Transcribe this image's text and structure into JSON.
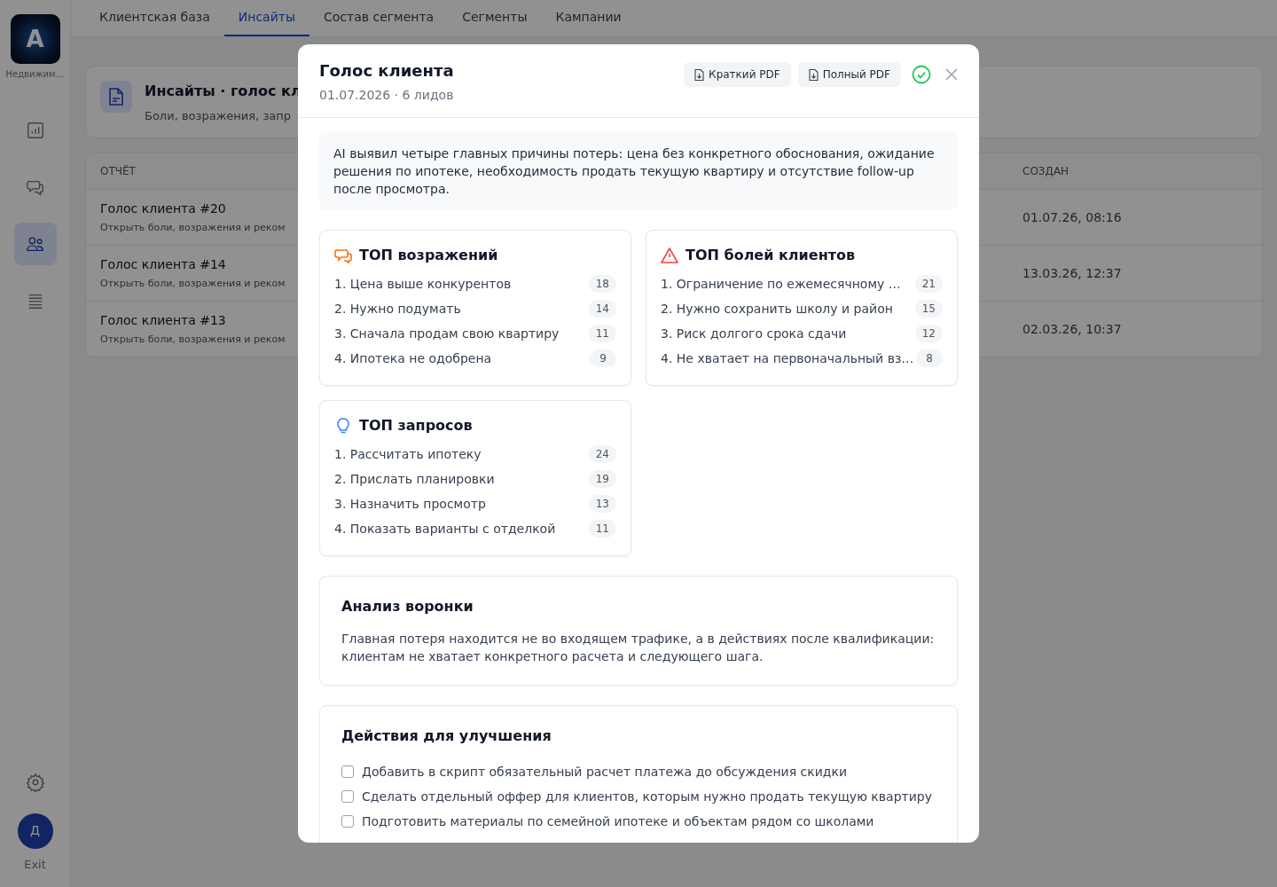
{
  "sidebar": {
    "logo_letter": "A",
    "workspace": "Недвижим…",
    "items": [
      {
        "kind": "chart",
        "selected": false
      },
      {
        "kind": "chat",
        "selected": false
      },
      {
        "kind": "users",
        "selected": true
      },
      {
        "kind": "list",
        "selected": false
      }
    ],
    "avatar": "Д",
    "exit": "Exit"
  },
  "tabs": [
    {
      "label": "Клиентская база",
      "selected": false
    },
    {
      "label": "Инсайты",
      "selected": true
    },
    {
      "label": "Состав сегмента",
      "selected": false
    },
    {
      "label": "Сегменты",
      "selected": false
    },
    {
      "label": "Кампании",
      "selected": false
    }
  ],
  "header": {
    "title": "Инсайты · голос кл",
    "subtitle": "Боли, возражения, запр"
  },
  "table": {
    "columns": [
      "ОТЧЁТ",
      "СОЗДАН"
    ],
    "rows": [
      {
        "title": "Голос клиента #20",
        "link": "Открыть боли, возражения и реком",
        "created": "01.07.26, 08:16"
      },
      {
        "title": "Голос клиента #14",
        "link": "Открыть боли, возражения и реком",
        "created": "13.03.26, 12:37"
      },
      {
        "title": "Голос клиента #13",
        "link": "Открыть боли, возражения и реком",
        "created": "02.03.26, 10:37"
      }
    ]
  },
  "modal": {
    "title": "Голос клиента",
    "subtitle": "01.07.2026 · 6 лидов",
    "buttons": [
      "Краткий PDF",
      "Полный PDF"
    ],
    "summary": "AI выявил четыре главных причины потерь: цена без конкретного обоснования, ожидание решения по ипотеке, необходимость продать текущую квартиру и отсутствие follow-up после просмотра.",
    "sections": [
      {
        "kind": "chat",
        "title": "ТОП возражений",
        "items": [
          {
            "text": "1. Цена выше конкурентов",
            "count": "18"
          },
          {
            "text": "2. Нужно подумать",
            "count": "14"
          },
          {
            "text": "3. Сначала продам свою квартиру",
            "count": "11"
          },
          {
            "text": "4. Ипотека не одобрена",
            "count": "9"
          }
        ]
      },
      {
        "kind": "alert",
        "title": "ТОП болей клиентов",
        "items": [
          {
            "text": "1. Ограничение по ежемесячному …",
            "count": "21"
          },
          {
            "text": "2. Нужно сохранить школу и район",
            "count": "15"
          },
          {
            "text": "3. Риск долгого срока сдачи",
            "count": "12"
          },
          {
            "text": "4. Не хватает на первоначальный вз…",
            "count": "8"
          }
        ]
      },
      {
        "kind": "idea",
        "title": "ТОП запросов",
        "items": [
          {
            "text": "1. Рассчитать ипотеку",
            "count": "24"
          },
          {
            "text": "2. Прислать планировки",
            "count": "19"
          },
          {
            "text": "3. Назначить просмотр",
            "count": "13"
          },
          {
            "text": "4. Показать варианты с отделкой",
            "count": "11"
          }
        ]
      }
    ],
    "funnel": {
      "title": "Анализ воронки",
      "text": "Главная потеря находится не во входящем трафике, а в действиях после квалификации: клиентам не хватает конкретного расчета и следующего шага."
    },
    "actions": {
      "title": "Действия для улучшения",
      "items": [
        {
          "text": "Добавить в скрипт обязательный расчет платежа до обсуждения скидки",
          "checked": false
        },
        {
          "text": "Сделать отдельный оффер для клиентов, которым нужно продать текущую квартиру",
          "checked": false
        },
        {
          "text": "Подготовить материалы по семейной ипотеке и объектам рядом со школами",
          "checked": false
        }
      ]
    }
  }
}
